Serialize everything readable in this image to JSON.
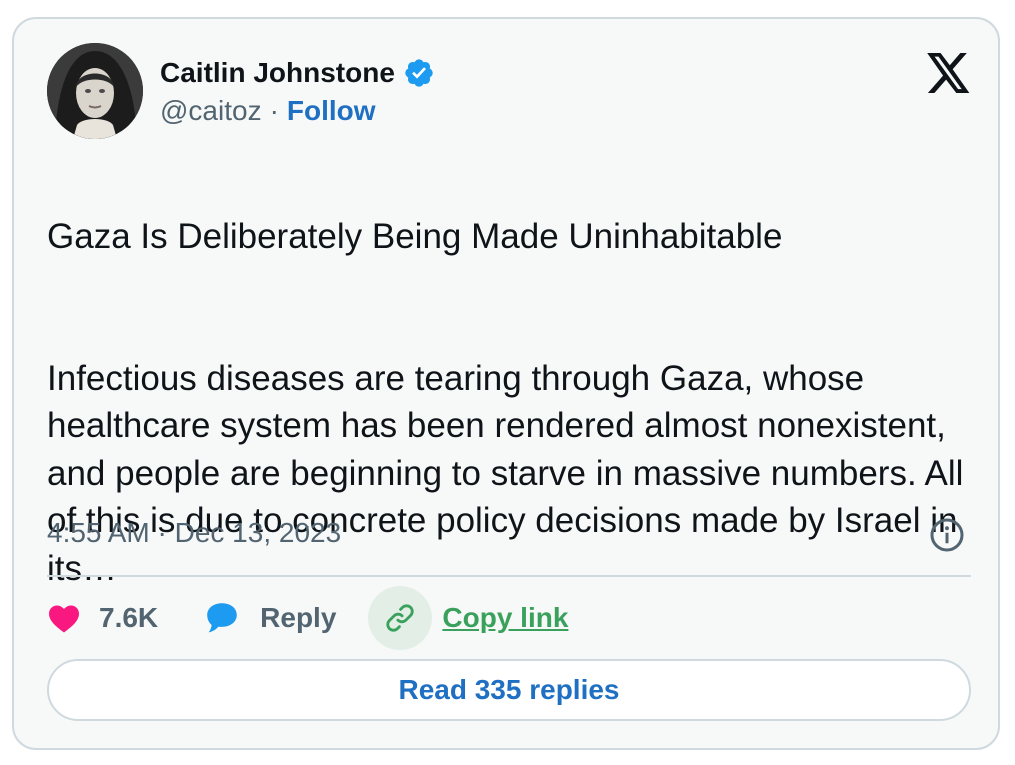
{
  "author": {
    "name": "Caitlin Johnstone",
    "handle": "@caitoz",
    "follow_label": "Follow",
    "separator": "·",
    "verified_icon": "verified-badge-icon"
  },
  "tweet": {
    "title": "Gaza Is Deliberately Being Made Uninhabitable",
    "body": "Infectious diseases are tearing through Gaza, whose healthcare system has been rendered almost nonexistent, and people are beginning to starve in massive numbers. All of this is due to concrete policy decisions made by Israel in its…",
    "timestamp": "4:55 AM · Dec 13, 2023"
  },
  "actions": {
    "like_count": "7.6K",
    "reply_label": "Reply",
    "copy_link_label": "Copy link"
  },
  "read_replies_label": "Read 335 replies",
  "colors": {
    "link_blue": "#1f6fc2",
    "like_pink": "#f91880",
    "reply_blue": "#1d9bf0",
    "copy_green": "#3aa15d",
    "border": "#cfd9de",
    "card_bg": "#f7f9f9"
  }
}
